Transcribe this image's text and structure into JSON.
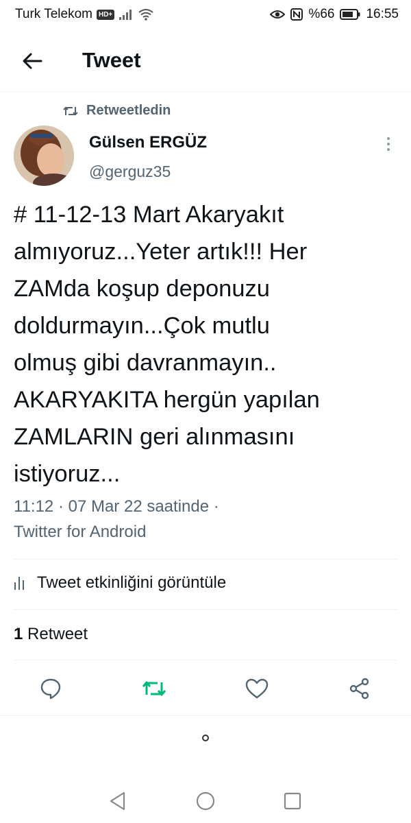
{
  "status_bar": {
    "carrier": "Turk Telekom",
    "network_badge": "HD+",
    "battery": "%66",
    "time": "16:55"
  },
  "header": {
    "title": "Tweet"
  },
  "tweet": {
    "retweet_context": "Retweetledin",
    "author_name": "Gülsen ERGÜZ",
    "author_handle": "@gerguz35",
    "text_lines": [
      "# 11-12-13 Mart Akaryakıt",
      "almıyoruz...Yeter artık!!! Her",
      "ZAMda koşup deponuzu",
      "doldurmayın...Çok mutlu",
      "olmuş gibi davranmayın..",
      "AKARYAKITA hergün yapılan",
      "ZAMLARIN geri alınmasını",
      "istiyoruz..."
    ],
    "timestamp": "11:12 · 07 Mar 22 saatinde ·",
    "source": "Twitter for Android",
    "activity_label": "Tweet etkinliğini görüntüle",
    "retweet_count": "1",
    "retweet_label": "Retweet"
  },
  "colors": {
    "text_primary": "#0f1419",
    "text_secondary": "#536471",
    "retweet_green": "#00ba7c",
    "divider": "#eff3f4"
  },
  "icons": {
    "back": "arrow-left-icon",
    "retweet_context": "retweet-icon",
    "more": "more-vertical-icon",
    "activity": "bar-chart-icon",
    "reply": "reply-icon",
    "retweet": "retweet-icon",
    "like": "heart-icon",
    "share": "share-icon"
  }
}
